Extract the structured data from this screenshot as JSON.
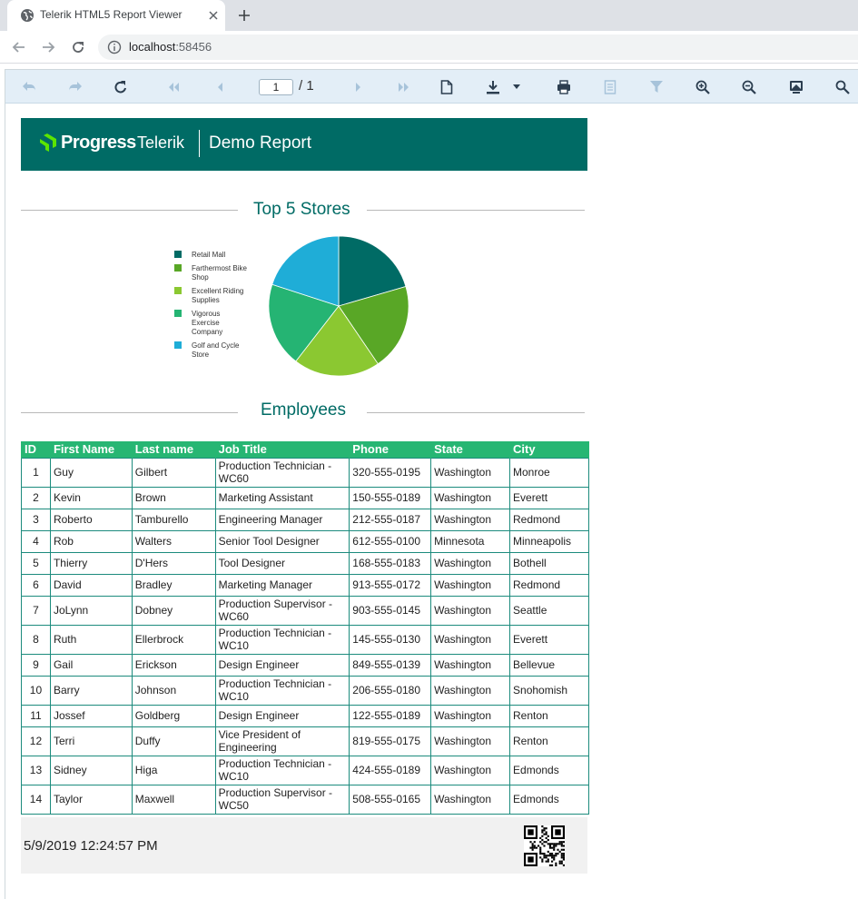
{
  "browser": {
    "tab_title": "Telerik HTML5 Report Viewer",
    "url_host": "localhost",
    "url_port": ":58456"
  },
  "toolbar": {
    "current_page": "1",
    "page_total": "/ 1"
  },
  "report": {
    "brand_progress": "Progress",
    "brand_telerik": "Telerik",
    "header_title": "Demo Report",
    "stores_title": "Top 5 Stores",
    "employees_title": "Employees",
    "footer_timestamp": "5/9/2019 12:24:57 PM"
  },
  "chart_data": {
    "type": "pie",
    "title": "Top 5 Stores",
    "legend_position": "left",
    "categories": [
      "Retail Mall",
      "Farthermost Bike Shop",
      "Excellent Riding Supplies",
      "Vigorous Exercise Company",
      "Golf and Cycle Store"
    ],
    "legend_lines": [
      [
        "Retail Mall"
      ],
      [
        "Farthermost Bike",
        "Shop"
      ],
      [
        "Excellent Riding",
        "Supplies"
      ],
      [
        "Vigorous",
        "Exercise",
        "Company"
      ],
      [
        "Golf and Cycle",
        "Store"
      ]
    ],
    "values": [
      20.5,
      20,
      20,
      19.5,
      20
    ],
    "colors": [
      "#006b65",
      "#59a726",
      "#8bc831",
      "#25b473",
      "#1fadd7"
    ]
  },
  "employees": {
    "columns": [
      "ID",
      "First Name",
      "Last name",
      "Job Title",
      "Phone",
      "State",
      "City"
    ],
    "rows": [
      [
        "1",
        "Guy",
        "Gilbert",
        "Production Technician - WC60",
        "320-555-0195",
        "Washington",
        "Monroe"
      ],
      [
        "2",
        "Kevin",
        "Brown",
        "Marketing Assistant",
        "150-555-0189",
        "Washington",
        "Everett"
      ],
      [
        "3",
        "Roberto",
        "Tamburello",
        "Engineering Manager",
        "212-555-0187",
        "Washington",
        "Redmond"
      ],
      [
        "4",
        "Rob",
        "Walters",
        "Senior Tool Designer",
        "612-555-0100",
        "Minnesota",
        "Minneapolis"
      ],
      [
        "5",
        "Thierry",
        "D'Hers",
        "Tool Designer",
        "168-555-0183",
        "Washington",
        "Bothell"
      ],
      [
        "6",
        "David",
        "Bradley",
        "Marketing Manager",
        "913-555-0172",
        "Washington",
        "Redmond"
      ],
      [
        "7",
        "JoLynn",
        "Dobney",
        "Production Supervisor - WC60",
        "903-555-0145",
        "Washington",
        "Seattle"
      ],
      [
        "8",
        "Ruth",
        "Ellerbrock",
        "Production Technician - WC10",
        "145-555-0130",
        "Washington",
        "Everett"
      ],
      [
        "9",
        "Gail",
        "Erickson",
        "Design Engineer",
        "849-555-0139",
        "Washington",
        "Bellevue"
      ],
      [
        "10",
        "Barry",
        "Johnson",
        "Production Technician - WC10",
        "206-555-0180",
        "Washington",
        "Snohomish"
      ],
      [
        "11",
        "Jossef",
        "Goldberg",
        "Design Engineer",
        "122-555-0189",
        "Washington",
        "Renton"
      ],
      [
        "12",
        "Terri",
        "Duffy",
        "Vice President of Engineering",
        "819-555-0175",
        "Washington",
        "Renton"
      ],
      [
        "13",
        "Sidney",
        "Higa",
        "Production Technician - WC10",
        "424-555-0189",
        "Washington",
        "Edmonds"
      ],
      [
        "14",
        "Taylor",
        "Maxwell",
        "Production Supervisor - WC50",
        "508-555-0165",
        "Washington",
        "Edmonds"
      ]
    ]
  },
  "colors": {
    "brand_teal": "#006b65",
    "table_header": "#27b673",
    "toolbar_bg": "#e3eef7"
  }
}
